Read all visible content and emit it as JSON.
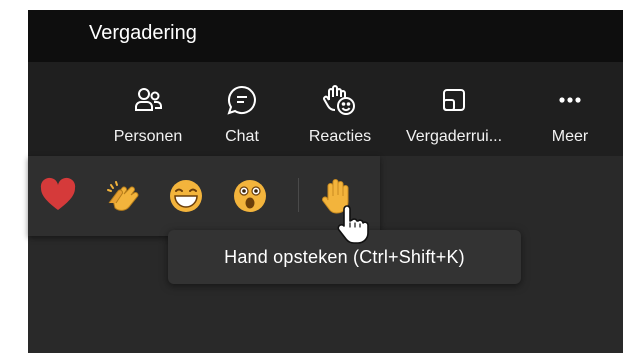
{
  "window": {
    "title": "Vergadering"
  },
  "toolbar": {
    "items": [
      {
        "label": "Personen",
        "icon": "people-icon"
      },
      {
        "label": "Chat",
        "icon": "chat-icon"
      },
      {
        "label": "Reacties",
        "icon": "reactions-icon"
      },
      {
        "label": "Vergaderrui...",
        "icon": "meeting-room-icon"
      },
      {
        "label": "Meer",
        "icon": "more-icon"
      }
    ]
  },
  "reactions": {
    "items": [
      {
        "icon": "heart-emoji-icon"
      },
      {
        "icon": "clapping-hands-emoji-icon"
      },
      {
        "icon": "laughing-emoji-icon"
      },
      {
        "icon": "surprised-emoji-icon"
      },
      {
        "icon": "raised-hand-emoji-icon"
      }
    ]
  },
  "tooltip": {
    "text": "Hand opsteken (Ctrl+Shift+K)"
  },
  "colors": {
    "titlebar": "#0e0e0e",
    "toolbar": "#1f1f1f",
    "flyout": "#2f2f2f",
    "stage": "#292929",
    "emoji_yellow": "#f3b43c",
    "heart_red": "#d53a3a"
  }
}
